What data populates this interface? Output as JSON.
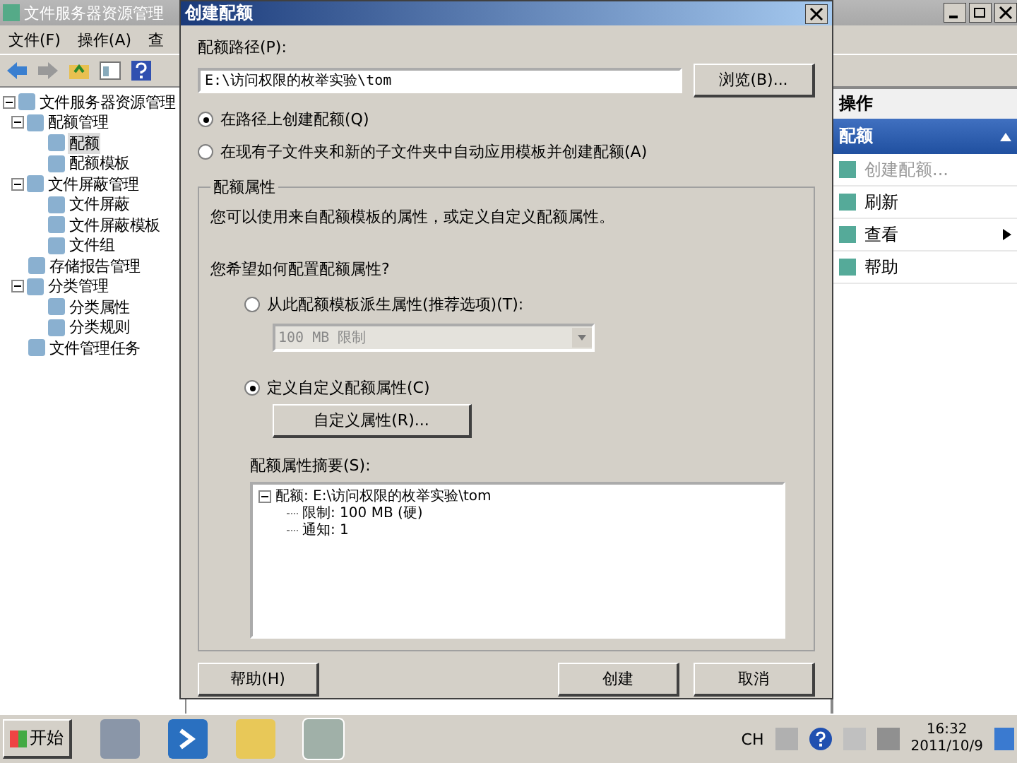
{
  "main_window": {
    "title": "文件服务器资源管理",
    "menu": [
      "文件(F)",
      "操作(A)",
      "查"
    ]
  },
  "tree": [
    {
      "label": "文件服务器资源管理",
      "expanded": true,
      "selected": false,
      "children": [
        {
          "label": "配额管理",
          "expanded": true,
          "selected": false,
          "children": [
            {
              "label": "配额",
              "selected": true
            },
            {
              "label": "配额模板",
              "selected": false
            }
          ]
        },
        {
          "label": "文件屏蔽管理",
          "expanded": true,
          "selected": false,
          "children": [
            {
              "label": "文件屏蔽",
              "selected": false
            },
            {
              "label": "文件屏蔽模板",
              "selected": false
            },
            {
              "label": "文件组",
              "selected": false
            }
          ]
        },
        {
          "label": "存储报告管理",
          "selected": false
        },
        {
          "label": "分类管理",
          "expanded": true,
          "selected": false,
          "children": [
            {
              "label": "分类属性",
              "selected": false
            },
            {
              "label": "分类规则",
              "selected": false
            }
          ]
        },
        {
          "label": "文件管理任务",
          "selected": false
        }
      ]
    }
  ],
  "actions": {
    "header": "操作",
    "section": "配额",
    "items": [
      {
        "label": "创建配额...",
        "disabled": true,
        "submenu": false
      },
      {
        "label": "刷新",
        "disabled": false,
        "submenu": false
      },
      {
        "label": "查看",
        "disabled": false,
        "submenu": true
      },
      {
        "label": "帮助",
        "disabled": false,
        "submenu": false
      }
    ]
  },
  "dialog": {
    "title": "创建配额",
    "path_label": "配额路径(P):",
    "path_value": "E:\\访问权限的枚举实验\\tom",
    "browse_button": "浏览(B)...",
    "modes": [
      {
        "label": "在路径上创建配额(Q)",
        "selected": true
      },
      {
        "label": "在现有子文件夹和新的子文件夹中自动应用模板并创建配额(A)",
        "selected": false
      }
    ],
    "group_title": "配额属性",
    "group_text": "您可以使用来自配额模板的属性，或定义自定义配额属性。",
    "question": "您希望如何配置配额属性?",
    "sources": [
      {
        "label": "从此配额模板派生属性(推荐选项)(T):",
        "selected": false
      },
      {
        "label": "定义自定义配额属性(C)",
        "selected": true
      }
    ],
    "template_select": {
      "value": "100 MB 限制",
      "disabled": true
    },
    "custom_button": "自定义属性(R)...",
    "summary_label": "配额属性摘要(S):",
    "summary": [
      {
        "label": "配额: E:\\访问权限的枚举实验\\tom",
        "expanded": true,
        "children": [
          {
            "label": "限制: 100 MB (硬)"
          },
          {
            "label": "通知: 1"
          }
        ]
      }
    ],
    "buttons": [
      "帮助(H)",
      "创建",
      "取消"
    ]
  },
  "taskbar": {
    "start": "开始",
    "language": "CH",
    "time": "16:32",
    "date": "2011/10/9"
  }
}
